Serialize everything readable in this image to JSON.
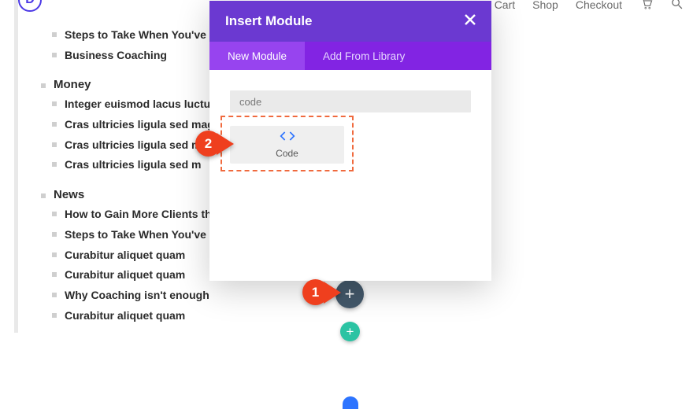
{
  "logo_letter": "D",
  "topnav": {
    "cart": "Cart",
    "shop": "Shop",
    "checkout": "Checkout"
  },
  "groups": {
    "g0": {
      "items": [
        "Steps to Take When You've L",
        "Business Coaching"
      ]
    },
    "g1": {
      "title": "Money",
      "items": [
        "Integer euismod lacus luctus",
        "Cras ultricies ligula sed mag",
        "Cras ultricies ligula sed ma",
        "Cras ultricies ligula sed m"
      ]
    },
    "g2": {
      "title": "News",
      "items": [
        "How to Gain More Clients th",
        "Steps to Take When You've L",
        "Curabitur aliquet quam",
        "Curabitur aliquet quam",
        "Why Coaching isn't enough",
        "Curabitur aliquet quam"
      ]
    }
  },
  "modal": {
    "title": "Insert Module",
    "tab_new": "New Module",
    "tab_lib": "Add From Library",
    "search_value": "code",
    "module_name": "Code"
  },
  "callouts": {
    "one": "1",
    "two": "2"
  },
  "plus": "+",
  "colors": {
    "purple_dark": "#6b39d1",
    "purple": "#8224e3",
    "purple_light": "#9744ef",
    "orange": "#ef3f1e",
    "teal": "#2bc3a3",
    "slate": "#43586a",
    "blue": "#2d74ff"
  }
}
